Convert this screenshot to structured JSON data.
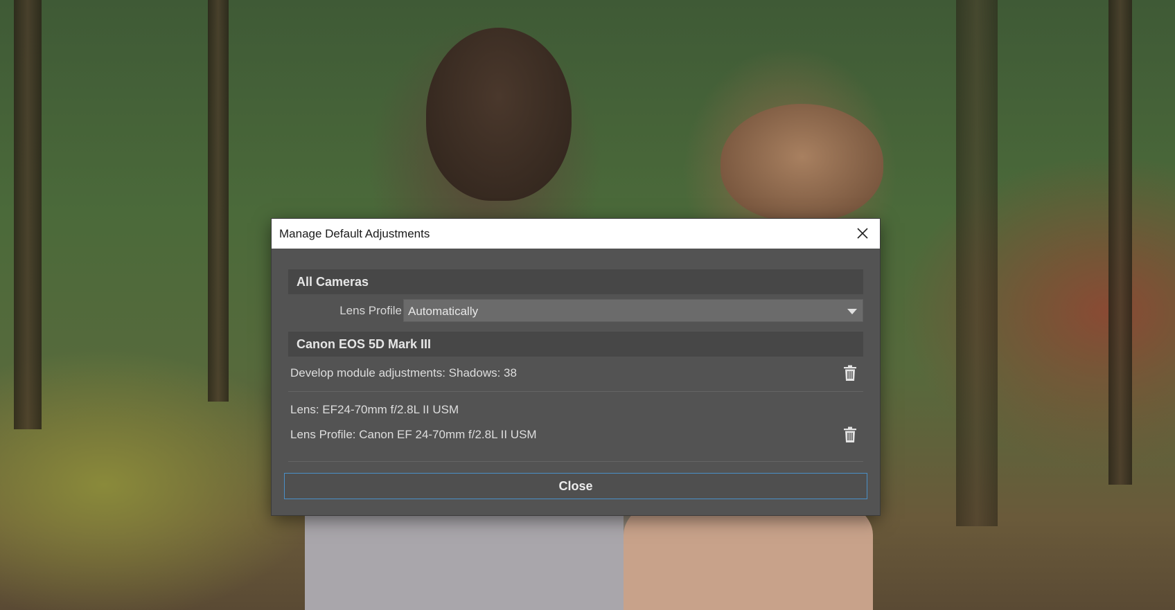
{
  "dialog": {
    "title": "Manage Default Adjustments",
    "close_button_label": "Close"
  },
  "all_cameras": {
    "header": "All Cameras",
    "lens_profile_label": "Lens Profile",
    "lens_profile_value": "Automatically"
  },
  "camera": {
    "header": "Canon EOS 5D Mark III",
    "entries": [
      {
        "lines": [
          "Develop module adjustments: Shadows: 38"
        ]
      },
      {
        "lines": [
          "Lens: EF24-70mm f/2.8L II USM",
          "Lens Profile: Canon EF 24-70mm f/2.8L II USM"
        ]
      }
    ]
  },
  "icons": {
    "close": "close-icon",
    "delete": "trash-icon",
    "dropdown": "chevron-down-icon"
  },
  "colors": {
    "dialog_background": "#535353",
    "section_header": "#474747",
    "focus_border": "#4a90c8"
  }
}
